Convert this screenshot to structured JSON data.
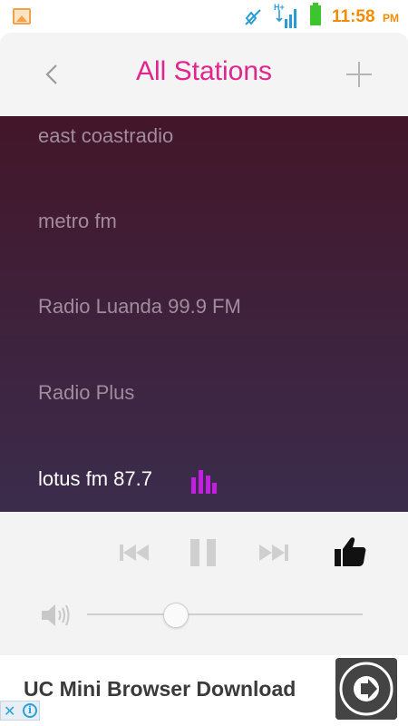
{
  "status_bar": {
    "time": "11:58",
    "ampm": "PM",
    "network": "H+"
  },
  "header": {
    "title": "All Stations"
  },
  "stations": [
    {
      "label": "east coastradio"
    },
    {
      "label": "metro fm"
    },
    {
      "label": "Radio Luanda 99.9 FM"
    },
    {
      "label": "Radio Plus"
    },
    {
      "label": "lotus fm 87.7",
      "playing": true
    }
  ],
  "player": {
    "state": "playing",
    "volume": 0.31
  },
  "ad": {
    "text": "UC Mini Browser Download"
  },
  "colors": {
    "accent": "#e0258f",
    "equalizer": "#c41fe0",
    "list_top": "#431629",
    "list_bottom": "#3b2c4d"
  }
}
